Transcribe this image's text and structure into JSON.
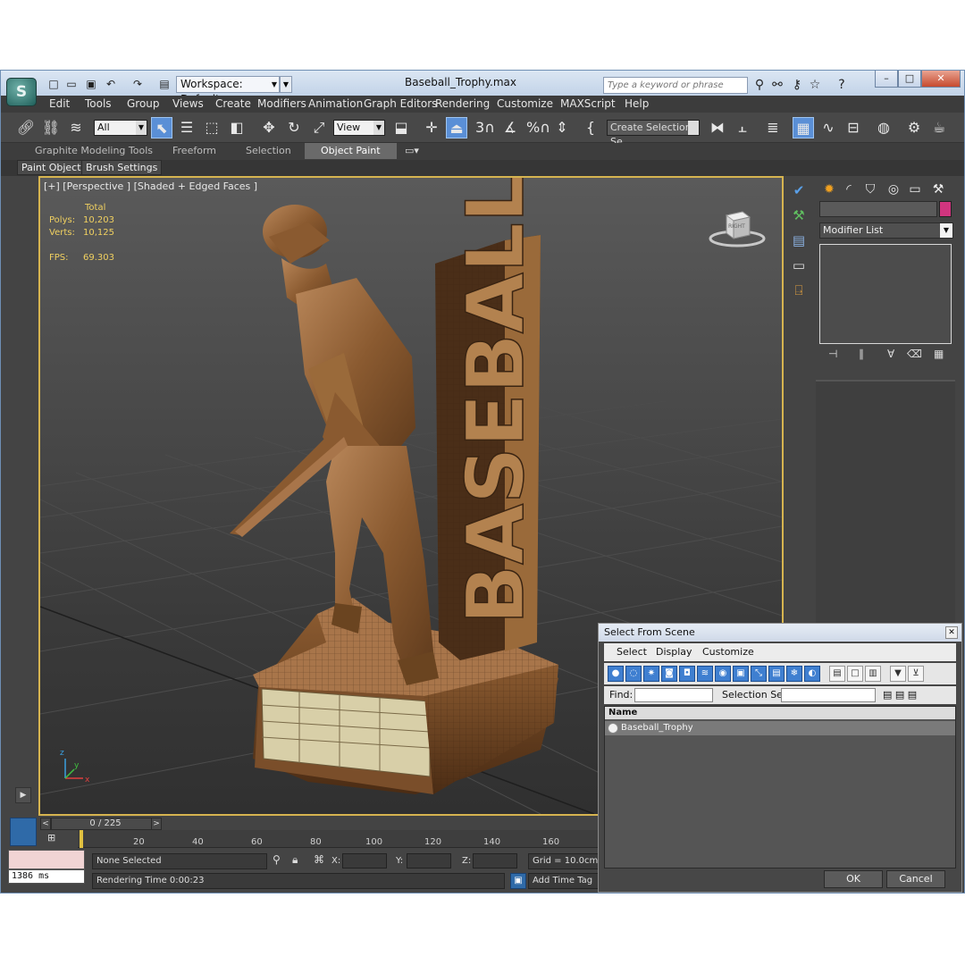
{
  "window": {
    "title": "Baseball_Trophy.max",
    "workspace": "Workspace: Default",
    "search_placeholder": "Type a keyword or phrase"
  },
  "menu": [
    "Edit",
    "Tools",
    "Group",
    "Views",
    "Create",
    "Modifiers",
    "Animation",
    "Graph Editors",
    "Rendering",
    "Customize",
    "MAXScript",
    "Help"
  ],
  "toolbar": {
    "filter_value": "All",
    "reference_coord": "View",
    "selection_set_placeholder": "Create Selection Se",
    "snap_3": "3",
    "snap_angle": "%"
  },
  "ribbon": {
    "tabs": [
      "Graphite Modeling Tools",
      "Freeform",
      "Selection",
      "Object Paint"
    ],
    "active_tab": "Object Paint",
    "subtabs": [
      "Paint Objects",
      "Brush Settings"
    ]
  },
  "viewport": {
    "label": "[+] [Perspective ] [Shaded + Edged Faces ]",
    "stats_header": "Total",
    "polys_label": "Polys:",
    "polys_value": "10,203",
    "verts_label": "Verts:",
    "verts_value": "10,125",
    "fps_label": "FPS:",
    "fps_value": "69.303",
    "viewcube_label": "RIGHT",
    "model_text": "BASEBALL"
  },
  "command_panel": {
    "modifier_list": "Modifier List"
  },
  "timeline": {
    "frame_display": "0 / 225",
    "ticks": [
      "20",
      "40",
      "60",
      "80",
      "100",
      "120",
      "140",
      "160"
    ]
  },
  "status": {
    "listener_output": "1386 ms",
    "selection": "None Selected",
    "rendering_time": "Rendering Time  0:00:23",
    "x_label": "X:",
    "y_label": "Y:",
    "z_label": "Z:",
    "grid": "Grid = 10.0cm",
    "add_time_tag": "Add Time Tag"
  },
  "dialog": {
    "title": "Select From Scene",
    "menu": [
      "Select",
      "Display",
      "Customize"
    ],
    "find_label": "Find:",
    "selection_set_label": "Selection Set:",
    "column_header": "Name",
    "rows": [
      "Baseball_Trophy"
    ],
    "ok_label": "OK",
    "cancel_label": "Cancel"
  },
  "colors": {
    "viewport_border": "#d6b450",
    "stats_text": "#f0d060",
    "object_color_swatch": "#d1357f",
    "active_tool": "#5a8fd6",
    "model_bronze": "#9a6a3a"
  }
}
